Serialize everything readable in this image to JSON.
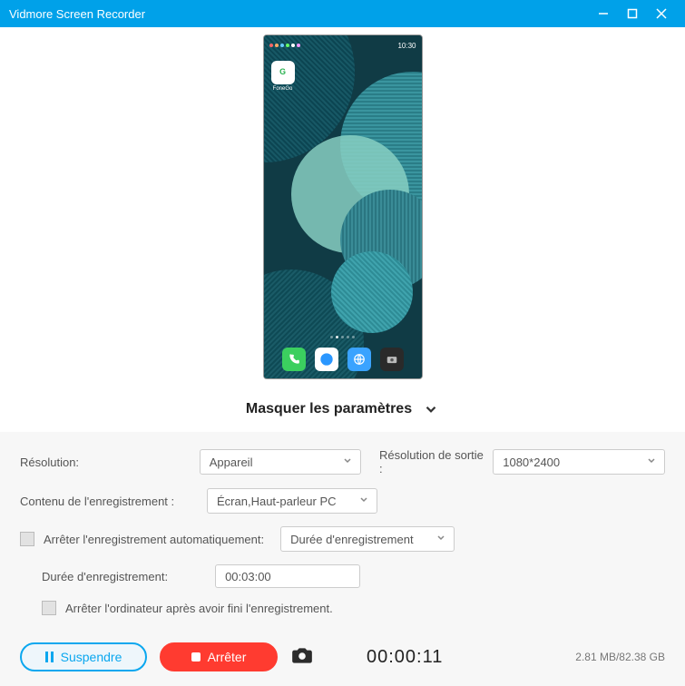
{
  "title": "Vidmore Screen Recorder",
  "phone": {
    "status_time": "10:30",
    "fonego_label": "FoneGo"
  },
  "toggle": {
    "label": "Masquer les paramètres"
  },
  "settings": {
    "resolution_label": "Résolution:",
    "resolution_value": "Appareil",
    "output_label": "Résolution de sortie :",
    "output_value": "1080*2400",
    "content_label": "Contenu de l'enregistrement :",
    "content_value": "Écran,Haut-parleur PC",
    "auto_stop_label": "Arrêter l'enregistrement automatiquement:",
    "auto_stop_mode": "Durée d'enregistrement",
    "duration_label": "Durée d'enregistrement:",
    "duration_value": "00:03:00",
    "shutdown_label": "Arrêter l'ordinateur après avoir fini l'enregistrement."
  },
  "actions": {
    "pause": "Suspendre",
    "stop": "Arrêter",
    "timer": "00:00:11",
    "storage": "2.81 MB/82.38 GB"
  }
}
